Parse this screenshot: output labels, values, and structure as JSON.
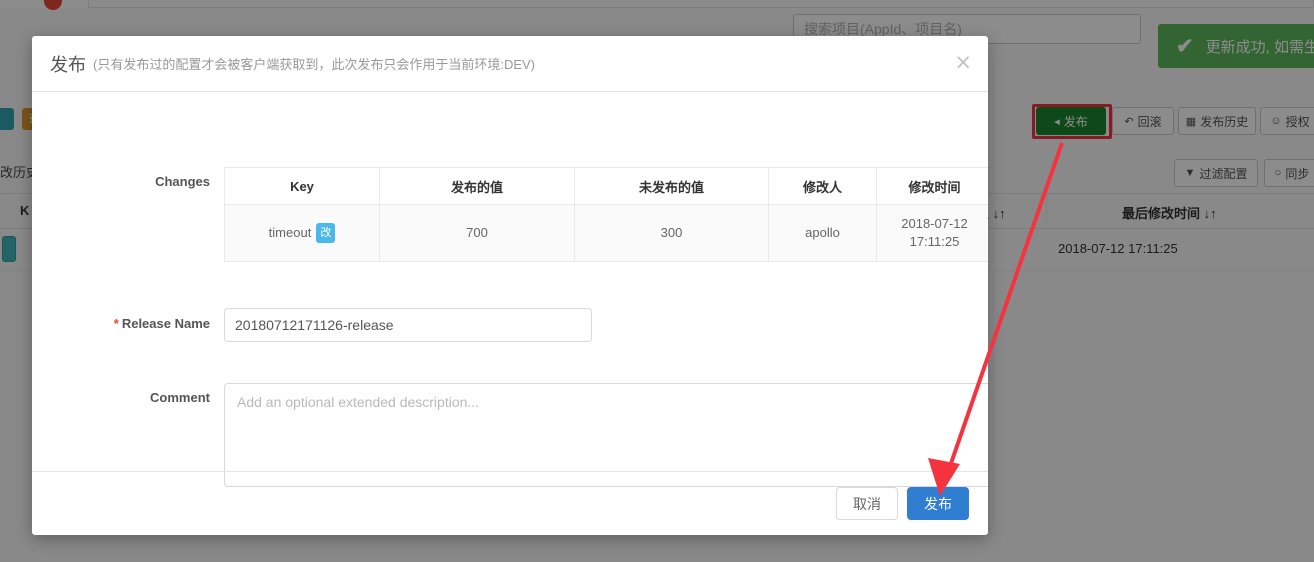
{
  "background": {
    "search": {
      "placeholder": "搜索项目(AppId、项目名)"
    },
    "toast": {
      "icon": "check-icon",
      "message": "更新成功, 如需生效"
    },
    "toolbar": [
      {
        "label": "发布",
        "icon": "send-icon",
        "style": "green"
      },
      {
        "label": "回滚",
        "icon": "undo-icon",
        "style": "default"
      },
      {
        "label": "发布历史",
        "icon": "calendar-icon",
        "style": "default"
      },
      {
        "label": "授权",
        "icon": "user-icon",
        "style": "default"
      }
    ],
    "secondary_toolbar": [
      {
        "label": "过滤配置",
        "icon": "filter-icon"
      },
      {
        "label": "同步",
        "icon": "sync-icon"
      }
    ],
    "history_label": "改历史",
    "table": {
      "headers": [
        "K",
        "人 ↓↑",
        "最后修改时间 ↓↑"
      ],
      "rows": [
        {
          "last_modified": "2018-07-12 17:11:25"
        }
      ]
    },
    "tags": [
      {
        "label": "",
        "color": "#31a5b5"
      },
      {
        "label": "查",
        "color": "#e09a2e"
      }
    ]
  },
  "modal": {
    "title": "发布",
    "subtitle": "(只有发布过的配置才会被客户端获取到，此次发布只会作用于当前环境:DEV)",
    "close_icon": "close-icon",
    "changes_label": "Changes",
    "changes_table": {
      "headers": [
        "Key",
        "发布的值",
        "未发布的值",
        "修改人",
        "修改时间"
      ],
      "rows": [
        {
          "key": "timeout",
          "badge": "改",
          "released_value": "700",
          "unreleased_value": "300",
          "modified_by": "apollo",
          "modified_time": "2018-07-12 17:11:25"
        }
      ]
    },
    "release_name": {
      "label": "Release Name",
      "required_marker": "*",
      "value": "20180712171126-release"
    },
    "comment": {
      "label": "Comment",
      "value": "",
      "placeholder": "Add an optional extended description..."
    },
    "footer": {
      "cancel_label": "取消",
      "submit_label": "发布"
    }
  },
  "colors": {
    "primary": "#2f7ed1",
    "success": "#5cb85c",
    "publish_green": "#18862f",
    "badge_blue": "#4ab8e8",
    "annotation_red": "#f5333f"
  }
}
